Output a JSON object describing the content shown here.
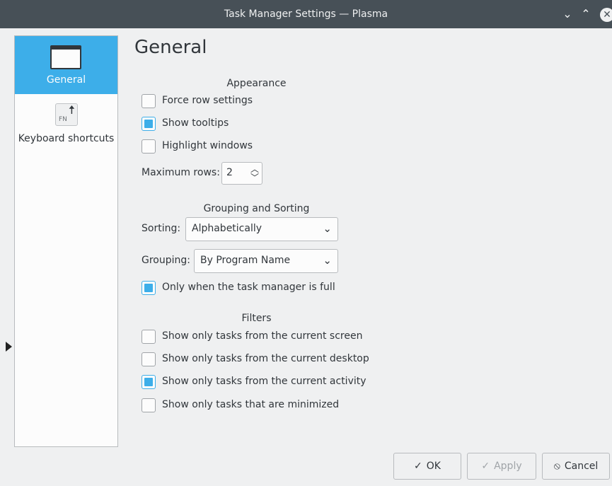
{
  "window": {
    "title": "Task Manager Settings — Plasma",
    "minimize_glyph": "⌄",
    "maximize_glyph": "⌃",
    "close_glyph": "✕"
  },
  "sidebar": {
    "items": [
      {
        "label": "General",
        "icon": "window-icon",
        "selected": true
      },
      {
        "label": "Keyboard shortcuts",
        "icon": "keyboard-key-icon",
        "fn_text": "FN",
        "selected": false
      }
    ]
  },
  "page": {
    "heading": "General",
    "appearance": {
      "title": "Appearance",
      "options": [
        {
          "label": "Force row settings",
          "checked": false
        },
        {
          "label": "Show tooltips",
          "checked": true
        },
        {
          "label": "Highlight windows",
          "checked": false
        }
      ],
      "max_rows_label": "Maximum rows:",
      "max_rows_value": "2"
    },
    "grouping": {
      "title": "Grouping and Sorting",
      "sorting_label": "Sorting:",
      "sorting_value": "Alphabetically",
      "grouping_label": "Grouping:",
      "grouping_value": "By Program Name",
      "only_when_full": {
        "label": "Only when the task manager is full",
        "checked": true
      }
    },
    "filters": {
      "title": "Filters",
      "options": [
        {
          "label": "Show only tasks from the current screen",
          "checked": false
        },
        {
          "label": "Show only tasks from the current desktop",
          "checked": false
        },
        {
          "label": "Show only tasks from the current activity",
          "checked": true
        },
        {
          "label": "Show only tasks that are minimized",
          "checked": false
        }
      ]
    }
  },
  "buttons": {
    "ok": {
      "label": "OK",
      "icon": "✓"
    },
    "apply": {
      "label": "Apply",
      "icon": "✓",
      "enabled": false
    },
    "cancel": {
      "label": "Cancel",
      "icon": "⦸"
    }
  },
  "colors": {
    "accent": "#3daee9",
    "titlebar": "#475057",
    "window_bg": "#eff0f1"
  }
}
